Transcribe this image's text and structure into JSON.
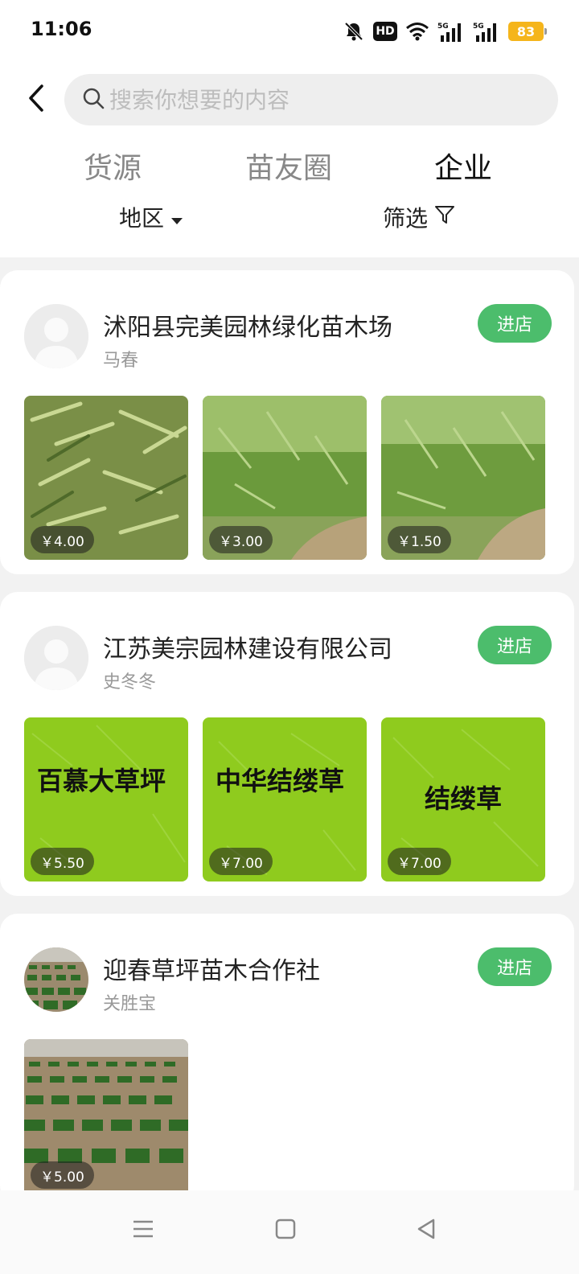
{
  "status_bar": {
    "time": "11:06",
    "hd_label": "HD",
    "battery": "83",
    "icons": [
      "bell-muted-icon",
      "hd-icon",
      "wifi-icon",
      "signal-5g-icon",
      "signal-5g-icon",
      "battery-icon"
    ]
  },
  "header": {
    "back_icon": "chevron-left-icon",
    "search_placeholder": "搜索你想要的内容",
    "search_icon": "search-icon"
  },
  "tabs": [
    {
      "label": "货源",
      "active": false
    },
    {
      "label": "苗友圈",
      "active": false
    },
    {
      "label": "企业",
      "active": true
    }
  ],
  "filters": {
    "region_label": "地区",
    "filter_label": "筛选"
  },
  "colors": {
    "accent": "#4cbd6c",
    "grass_green": "#8ccc1c"
  },
  "shops": [
    {
      "name": "沭阳县完美园林绿化苗木场",
      "owner": "马春",
      "enter_label": "进店",
      "products": [
        {
          "price": "￥4.00"
        },
        {
          "price": "￥3.00"
        },
        {
          "price": "￥1.50"
        }
      ]
    },
    {
      "name": "江苏美宗园林建设有限公司",
      "owner": "史冬冬",
      "enter_label": "进店",
      "products": [
        {
          "price": "￥5.50",
          "text": "百慕大草坪"
        },
        {
          "price": "￥7.00",
          "text": "中华结缕草"
        },
        {
          "price": "￥7.00",
          "text": "结缕草"
        }
      ]
    },
    {
      "name": "迎春草坪苗木合作社",
      "owner": "关胜宝",
      "enter_label": "进店",
      "products": [
        {
          "price": "￥5.00"
        }
      ]
    }
  ],
  "nav": {
    "menu_icon": "menu-icon",
    "home_icon": "home-square-icon",
    "back_icon": "back-triangle-icon"
  }
}
